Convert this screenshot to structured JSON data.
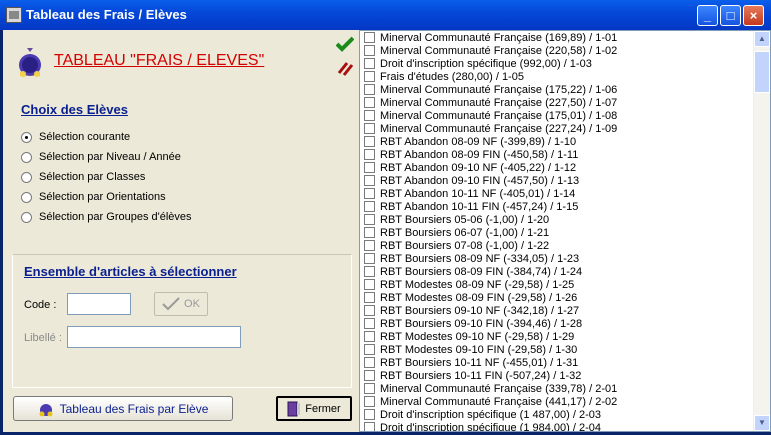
{
  "window": {
    "title": "Tableau des Frais / Elèves",
    "buttons": {
      "minimize": "_",
      "maximize": "□",
      "close": "×"
    }
  },
  "header": {
    "title": "TABLEAU \"FRAIS / ELEVES\"",
    "icon": "money-bag-icon",
    "accent_color": "#D40000"
  },
  "choix": {
    "title": "Choix des Elèves",
    "options": [
      {
        "label": "Sélection courante",
        "checked": true
      },
      {
        "label": "Sélection par Niveau / Année",
        "checked": false
      },
      {
        "label": "Sélection par Classes",
        "checked": false
      },
      {
        "label": "Sélection par Orientations",
        "checked": false
      },
      {
        "label": "Sélection par Groupes d'élèves",
        "checked": false
      }
    ]
  },
  "articles": {
    "title": "Ensemble d'articles à sélectionner",
    "code_label": "Code :",
    "code_value": "",
    "ok_label": "OK",
    "libelle_label": "Libellé :",
    "libelle_value": ""
  },
  "footer": {
    "tableau_button": "Tableau des Frais par Elève",
    "fermer_button": "Fermer"
  },
  "list_items": [
    "Minerval Communauté Française  (169,89)  /  1-01",
    "Minerval Communauté Française  (220,58)  /  1-02",
    "Droit d'inscription spécifique  (992,00)  /  1-03",
    "Frais d'études  (280,00)  /  1-05",
    "Minerval Communauté Française  (175,22)  /  1-06",
    "Minerval Communauté Française  (227,50)  /  1-07",
    "Minerval Communauté Française  (175,01)  /  1-08",
    "Minerval Communauté Française  (227,24)  /  1-09",
    "RBT Abandon 08-09 NF  (-399,89)  /  1-10",
    "RBT Abandon 08-09 FIN  (-450,58)  /  1-11",
    "RBT Abandon 09-10 NF  (-405,22)  /  1-12",
    "RBT Abandon 09-10 FIN  (-457,50)  /  1-13",
    "RBT Abandon 10-11 NF  (-405,01)  /  1-14",
    "RBT Abandon 10-11 FIN  (-457,24)  /  1-15",
    "RBT Boursiers 05-06  (-1,00)  /  1-20",
    "RBT Boursiers 06-07  (-1,00)  /  1-21",
    "RBT Boursiers 07-08  (-1,00)  /  1-22",
    "RBT Boursiers 08-09 NF  (-334,05)  /  1-23",
    "RBT Boursiers 08-09 FIN  (-384,74)  /  1-24",
    "RBT Modestes 08-09 NF  (-29,58)  /  1-25",
    "RBT Modestes 08-09 FIN  (-29,58)  /  1-26",
    "RBT Boursiers 09-10 NF  (-342,18)  /  1-27",
    "RBT Boursiers 09-10 FIN  (-394,46)  /  1-28",
    "RBT Modestes 09-10 NF  (-29,58)  /  1-29",
    "RBT Modestes 09-10 FIN  (-29,58)  /  1-30",
    "RBT Boursiers 10-11 NF  (-455,01)  /  1-31",
    "RBT Boursiers 10-11 FIN  (-507,24)  /  1-32",
    "Minerval Communauté Française  (339,78)  /  2-01",
    "Minerval Communauté Française  (441,17)  /  2-02",
    "Droit d'inscription spécifique  (1 487,00)  /  2-03",
    "Droit d'inscription spécifique  (1 984,00)  /  2-04"
  ]
}
